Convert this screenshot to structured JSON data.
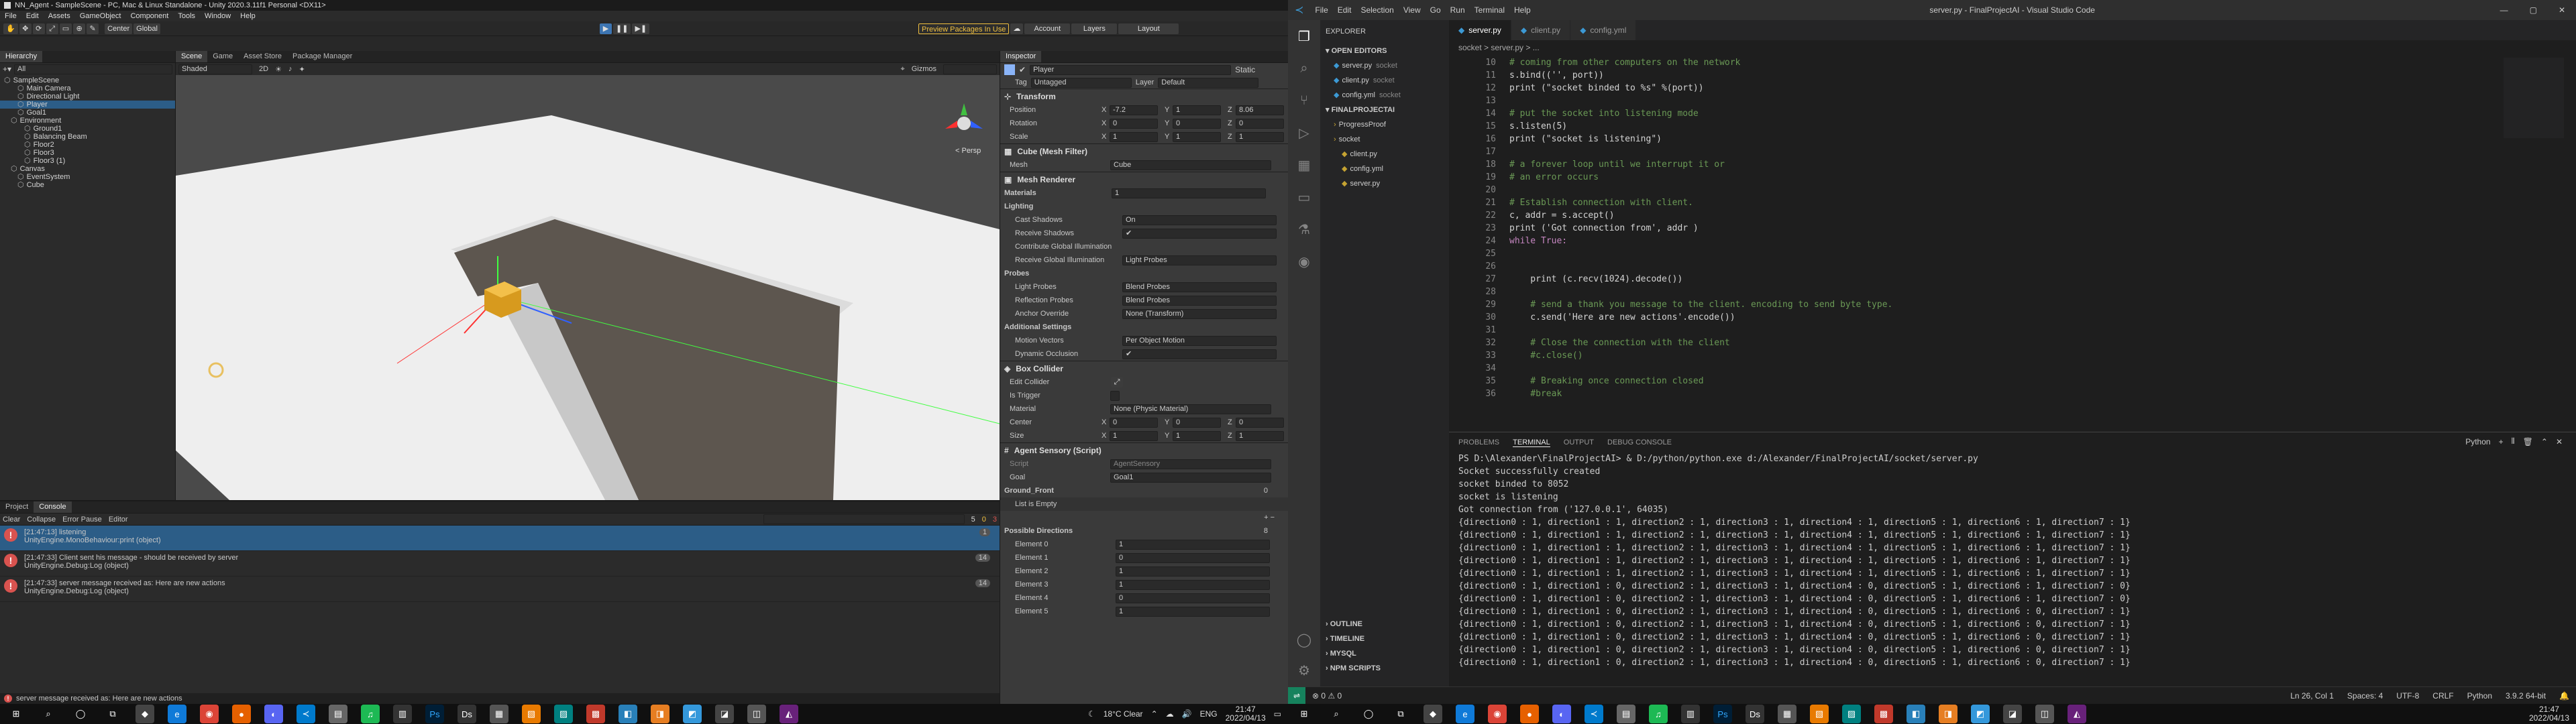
{
  "unity": {
    "title": "NN_Agent - SampleScene - PC, Mac & Linux Standalone - Unity 2020.3.11f1 Personal <DX11>",
    "menu": [
      "File",
      "Edit",
      "Assets",
      "GameObject",
      "Component",
      "Tools",
      "Window",
      "Help"
    ],
    "toolbar": {
      "center": "Center",
      "global": "Global",
      "preview_packages": "Preview Packages In Use",
      "account": "Account",
      "layers": "Layers",
      "layout": "Layout"
    },
    "hierarchy": {
      "tab": "Hierarchy",
      "search_placeholder": "All",
      "items": [
        {
          "label": "SampleScene",
          "indent": 0
        },
        {
          "label": "Main Camera",
          "indent": 2
        },
        {
          "label": "Directional Light",
          "indent": 2
        },
        {
          "label": "Player",
          "indent": 2,
          "selected": true
        },
        {
          "label": "Goal1",
          "indent": 2
        },
        {
          "label": "Environment",
          "indent": 1
        },
        {
          "label": "Ground1",
          "indent": 3
        },
        {
          "label": "Balancing Beam",
          "indent": 3
        },
        {
          "label": "Floor2",
          "indent": 3
        },
        {
          "label": "Floor3",
          "indent": 3
        },
        {
          "label": "Floor3 (1)",
          "indent": 3
        },
        {
          "label": "Canvas",
          "indent": 1
        },
        {
          "label": "EventSystem",
          "indent": 2
        },
        {
          "label": "Cube",
          "indent": 2
        }
      ]
    },
    "scene": {
      "tabs": [
        "Scene",
        "Game",
        "Asset Store",
        "Package Manager"
      ],
      "shading": "Shaded",
      "mode_2d": "2D",
      "gizmos": "Gizmos",
      "persp": "< Persp"
    },
    "project": {
      "tabs": [
        "Project",
        "Console"
      ],
      "toolbar": [
        "Clear",
        "Collapse",
        "Error Pause",
        "Editor"
      ],
      "counts": [
        "5",
        "0",
        "3"
      ],
      "logs": [
        {
          "time": "[21:47:13] listening",
          "detail": "UnityEngine.MonoBehaviour:print (object)",
          "count": "1",
          "sel": true
        },
        {
          "time": "[21:47:33] Client sent his message - should be received by server",
          "detail": "UnityEngine.Debug:Log (object)",
          "count": "14",
          "sel": false
        },
        {
          "time": "[21:47:33] server message received as: Here are new actions",
          "detail": "UnityEngine.Debug:Log (object)",
          "count": "14",
          "sel": false
        }
      ],
      "status": "server message received as: Here are new actions"
    },
    "inspector": {
      "tab": "Inspector",
      "object_name": "Player",
      "static": "Static",
      "tag_label": "Tag",
      "tag": "Untagged",
      "layer_label": "Layer",
      "layer": "Default",
      "transform": {
        "title": "Transform",
        "rows": [
          {
            "label": "Position",
            "x": "-7.2",
            "y": "1",
            "z": "8.06"
          },
          {
            "label": "Rotation",
            "x": "0",
            "y": "0",
            "z": "0"
          },
          {
            "label": "Scale",
            "x": "1",
            "y": "1",
            "z": "1"
          }
        ]
      },
      "mesh_filter": {
        "title": "Cube (Mesh Filter)",
        "mesh_label": "Mesh",
        "mesh": "Cube"
      },
      "mesh_renderer": {
        "title": "Mesh Renderer",
        "rows": [
          {
            "label": "Materials",
            "value": "1",
            "bold": true
          },
          {
            "label": "Lighting",
            "value": "",
            "bold": true
          },
          {
            "label": "Cast Shadows",
            "value": "On"
          },
          {
            "label": "Receive Shadows",
            "value": "✔"
          },
          {
            "label": "Contribute Global Illumination",
            "value": ""
          },
          {
            "label": "Receive Global Illumination",
            "value": "Light Probes"
          },
          {
            "label": "Probes",
            "value": "",
            "bold": true
          },
          {
            "label": "Light Probes",
            "value": "Blend Probes"
          },
          {
            "label": "Reflection Probes",
            "value": "Blend Probes"
          },
          {
            "label": "Anchor Override",
            "value": "None (Transform)"
          },
          {
            "label": "Additional Settings",
            "value": "",
            "bold": true
          },
          {
            "label": "Motion Vectors",
            "value": "Per Object Motion"
          },
          {
            "label": "Dynamic Occlusion",
            "value": "✔"
          }
        ]
      },
      "box_collider": {
        "title": "Box Collider",
        "edit_label": "Edit Collider",
        "trigger_label": "Is Trigger",
        "material_label": "Material",
        "material": "None (Physic Material)",
        "center": {
          "label": "Center",
          "x": "0",
          "y": "0",
          "z": "0"
        },
        "size": {
          "label": "Size",
          "x": "1",
          "y": "1",
          "z": "1"
        }
      },
      "agent": {
        "title": "Agent Sensory (Script)",
        "script_label": "Script",
        "script": "AgentSensory",
        "goal_label": "Goal",
        "goal": "Goal1",
        "ground_label": "Ground_Front",
        "ground_count": "0",
        "list_empty": "List is Empty",
        "dir_label": "Possible Directions",
        "dir_count": "8",
        "elements": [
          {
            "label": "Element 0",
            "value": "1"
          },
          {
            "label": "Element 1",
            "value": "0"
          },
          {
            "label": "Element 2",
            "value": "1"
          },
          {
            "label": "Element 3",
            "value": "1"
          },
          {
            "label": "Element 4",
            "value": "0"
          },
          {
            "label": "Element 5",
            "value": "1"
          }
        ]
      }
    }
  },
  "vscode": {
    "menu": [
      "File",
      "Edit",
      "Selection",
      "View",
      "Go",
      "Run",
      "Terminal",
      "Help"
    ],
    "title": "server.py - FinalProjectAI - Visual Studio Code",
    "explorer": {
      "header": "EXPLORER",
      "open_editors": "OPEN EDITORS",
      "open": [
        {
          "name": "server.py",
          "dir": "socket"
        },
        {
          "name": "client.py",
          "dir": "socket"
        },
        {
          "name": "config.yml",
          "dir": "socket"
        }
      ],
      "project": "FINALPROJECTAI",
      "tree": [
        {
          "name": "ProgressProof",
          "indent": 1
        },
        {
          "name": "socket",
          "indent": 1
        },
        {
          "name": "client.py",
          "indent": 2
        },
        {
          "name": "config.yml",
          "indent": 2
        },
        {
          "name": "server.py",
          "indent": 2
        }
      ],
      "bottom": [
        "OUTLINE",
        "TIMELINE",
        "MYSQL",
        "NPM SCRIPTS"
      ]
    },
    "tabs": [
      {
        "label": "server.py",
        "on": true
      },
      {
        "label": "client.py",
        "on": false
      },
      {
        "label": "config.yml",
        "on": false
      }
    ],
    "breadcrumb": "socket > server.py > ...",
    "code": [
      {
        "n": "10",
        "t": "# coming from other computers on the network",
        "c": "cm"
      },
      {
        "n": "11",
        "t": "s.bind(('', port))",
        "c": ""
      },
      {
        "n": "12",
        "t": "print (\"socket binded to %s\" %(port))",
        "c": ""
      },
      {
        "n": "13",
        "t": "",
        "c": ""
      },
      {
        "n": "14",
        "t": "# put the socket into listening mode",
        "c": "cm"
      },
      {
        "n": "15",
        "t": "s.listen(5)",
        "c": ""
      },
      {
        "n": "16",
        "t": "print (\"socket is listening\")",
        "c": ""
      },
      {
        "n": "17",
        "t": "",
        "c": ""
      },
      {
        "n": "18",
        "t": "# a forever loop until we interrupt it or",
        "c": "cm"
      },
      {
        "n": "19",
        "t": "# an error occurs",
        "c": "cm"
      },
      {
        "n": "20",
        "t": "",
        "c": ""
      },
      {
        "n": "21",
        "t": "# Establish connection with client.",
        "c": "cm"
      },
      {
        "n": "22",
        "t": "c, addr = s.accept()",
        "c": ""
      },
      {
        "n": "23",
        "t": "print ('Got connection from', addr )",
        "c": ""
      },
      {
        "n": "24",
        "t": "while True:",
        "c": "kw"
      },
      {
        "n": "25",
        "t": "",
        "c": ""
      },
      {
        "n": "26",
        "t": "",
        "c": ""
      },
      {
        "n": "27",
        "t": "    print (c.recv(1024).decode())",
        "c": ""
      },
      {
        "n": "28",
        "t": "",
        "c": ""
      },
      {
        "n": "29",
        "t": "    # send a thank you message to the client. encoding to send byte type.",
        "c": "cm"
      },
      {
        "n": "30",
        "t": "    c.send('Here are new actions'.encode())",
        "c": ""
      },
      {
        "n": "31",
        "t": "",
        "c": ""
      },
      {
        "n": "32",
        "t": "    # Close the connection with the client",
        "c": "cm"
      },
      {
        "n": "33",
        "t": "    #c.close()",
        "c": "cm"
      },
      {
        "n": "34",
        "t": "",
        "c": ""
      },
      {
        "n": "35",
        "t": "    # Breaking once connection closed",
        "c": "cm"
      },
      {
        "n": "36",
        "t": "    #break",
        "c": "cm"
      }
    ],
    "terminal": {
      "tabs": [
        "PROBLEMS",
        "TERMINAL",
        "OUTPUT",
        "DEBUG CONSOLE"
      ],
      "shell": "Python",
      "lines": [
        "PS D:\\Alexander\\FinalProjectAI> & D:/python/python.exe d:/Alexander/FinalProjectAI/socket/server.py",
        "Socket successfully created",
        "socket binded to 8052",
        "socket is listening",
        "Got connection from ('127.0.0.1', 64035)",
        "{direction0 : 1, direction1 : 1, direction2 : 1, direction3 : 1, direction4 : 1, direction5 : 1, direction6 : 1, direction7 : 1}",
        "{direction0 : 1, direction1 : 1, direction2 : 1, direction3 : 1, direction4 : 1, direction5 : 1, direction6 : 1, direction7 : 1}",
        "{direction0 : 1, direction1 : 1, direction2 : 1, direction3 : 1, direction4 : 1, direction5 : 1, direction6 : 1, direction7 : 1}",
        "{direction0 : 1, direction1 : 1, direction2 : 1, direction3 : 1, direction4 : 1, direction5 : 1, direction6 : 1, direction7 : 1}",
        "{direction0 : 1, direction1 : 1, direction2 : 1, direction3 : 1, direction4 : 1, direction5 : 1, direction6 : 1, direction7 : 1}",
        "{direction0 : 1, direction1 : 0, direction2 : 1, direction3 : 1, direction4 : 0, direction5 : 1, direction6 : 1, direction7 : 0}",
        "{direction0 : 1, direction1 : 0, direction2 : 1, direction3 : 1, direction4 : 0, direction5 : 1, direction6 : 1, direction7 : 0}",
        "{direction0 : 1, direction1 : 0, direction2 : 1, direction3 : 1, direction4 : 0, direction5 : 1, direction6 : 0, direction7 : 1}",
        "{direction0 : 1, direction1 : 0, direction2 : 1, direction3 : 1, direction4 : 0, direction5 : 1, direction6 : 0, direction7 : 1}",
        "{direction0 : 1, direction1 : 0, direction2 : 1, direction3 : 1, direction4 : 0, direction5 : 1, direction6 : 0, direction7 : 1}",
        "{direction0 : 1, direction1 : 0, direction2 : 1, direction3 : 1, direction4 : 0, direction5 : 1, direction6 : 0, direction7 : 1}",
        "{direction0 : 1, direction1 : 0, direction2 : 1, direction3 : 1, direction4 : 0, direction5 : 1, direction6 : 0, direction7 : 1}"
      ]
    },
    "status": {
      "position": "Ln 26, Col 1",
      "spaces": "Spaces: 4",
      "encoding": "UTF-8",
      "eol": "CRLF",
      "lang": "Python",
      "version": "3.9.2 64-bit"
    }
  },
  "taskbar": {
    "left_weather": "18°C  Clear",
    "left_lang": "ENG",
    "left_time": "21:47",
    "left_date": "2022/04/13",
    "right_time": "21:47",
    "right_date": "2022/04/13"
  },
  "colors": {
    "unity_bg": "#282828",
    "vscode_bg": "#1e1e1e",
    "accent_blue": "#2c5d87",
    "error": "#d9534f"
  }
}
